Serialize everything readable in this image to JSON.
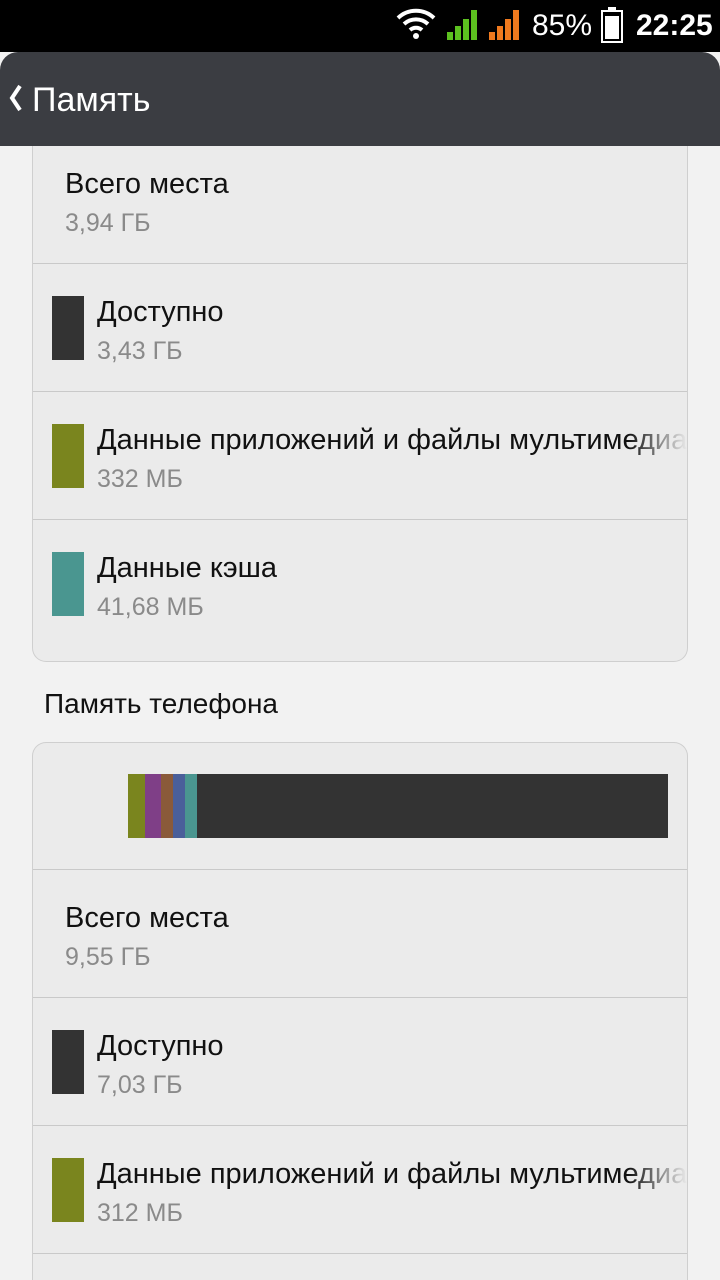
{
  "status_bar": {
    "battery_percent": "85%",
    "time": "22:25",
    "icons": [
      "wifi-icon",
      "signal-sim1-icon",
      "signal-sim2-icon",
      "battery-icon"
    ],
    "colors": {
      "sim1": "#5cc11f",
      "sim2": "#f07a1e"
    }
  },
  "action_bar": {
    "title": "Память",
    "back_icon": "chevron-left-icon"
  },
  "storage_card_top": {
    "rows": [
      {
        "label": "Всего места",
        "value": "3,94 ГБ"
      },
      {
        "label": "Доступно",
        "value": "3,43 ГБ",
        "color": "#333333"
      },
      {
        "label": "Данные приложений и файлы мультимедиа",
        "value": "332 МБ",
        "color": "#7a851e"
      },
      {
        "label": "Данные кэша",
        "value": "41,68 МБ",
        "color": "#4a9690"
      }
    ]
  },
  "phone_memory": {
    "section_title": "Память телефона",
    "usage_bar": {
      "segments": [
        {
          "name": "apps",
          "color": "#7a851e",
          "fraction": 0.032
        },
        {
          "name": "pictures",
          "color": "#7f3f87",
          "fraction": 0.03
        },
        {
          "name": "audio",
          "color": "#8a5a3a",
          "fraction": 0.022
        },
        {
          "name": "downloads",
          "color": "#4a5f9a",
          "fraction": 0.022
        },
        {
          "name": "cache",
          "color": "#4a9690",
          "fraction": 0.022
        },
        {
          "name": "available",
          "color": "#333333",
          "fraction": 0.872
        }
      ]
    },
    "rows": [
      {
        "label": "Всего места",
        "value": "9,55 ГБ"
      },
      {
        "label": "Доступно",
        "value": "7,03 ГБ",
        "color": "#333333"
      },
      {
        "label": "Данные приложений и файлы мультимедиа",
        "value": "312 МБ",
        "color": "#7a851e"
      }
    ]
  }
}
